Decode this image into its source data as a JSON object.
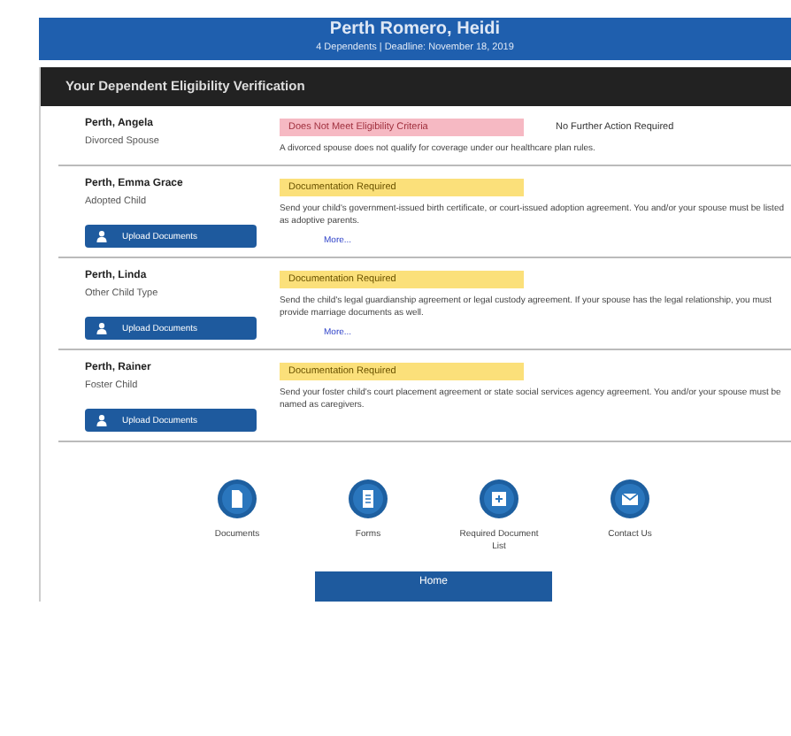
{
  "header": {
    "title": "Perth Romero, Heidi",
    "subtitle": "4 Dependents | Deadline: November 18, 2019"
  },
  "section_title": "Your Dependent Eligibility Verification",
  "dependents": [
    {
      "name": "Perth, Angela",
      "relation": "Divorced Spouse",
      "status": {
        "kind": "not_met",
        "text": "Does Not Meet Eligibility Criteria"
      },
      "note": "No Further Action Required",
      "description": "A divorced spouse does not qualify for coverage under our healthcare plan rules."
    },
    {
      "name": "Perth, Emma Grace",
      "relation": "Adopted Child",
      "status": {
        "kind": "required",
        "text": "Documentation Required"
      },
      "description": "Send your child's government-issued birth certificate, or court-issued adoption agreement. You and/or your spouse must be listed as adoptive parents.",
      "button": "Upload Documents",
      "link": "More..."
    },
    {
      "name": "Perth, Linda",
      "relation": "Other Child Type",
      "status": {
        "kind": "required",
        "text": "Documentation Required"
      },
      "description": "Send the child's legal guardianship agreement or legal custody agreement. If your spouse has the legal relationship, you must provide marriage documents as well.",
      "button": "Upload Documents",
      "link": "More..."
    },
    {
      "name": "Perth, Rainer",
      "relation": "Foster Child",
      "status": {
        "kind": "required",
        "text": "Documentation Required"
      },
      "description": "Send your foster child's court placement agreement or state social services agency agreement. You and/or your spouse must be named as caregivers.",
      "button": "Upload Documents"
    }
  ],
  "quick_links": [
    {
      "kind": "documents",
      "label": "Documents"
    },
    {
      "kind": "forms",
      "label": "Forms"
    },
    {
      "kind": "list",
      "label": "Required Document List"
    },
    {
      "kind": "contact",
      "label": "Contact Us"
    }
  ],
  "bottom_button": "Home"
}
